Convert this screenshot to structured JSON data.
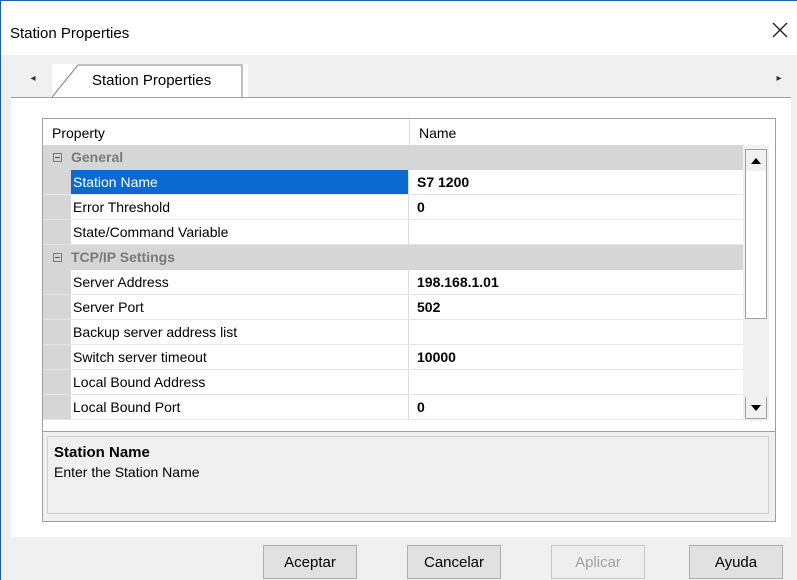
{
  "window": {
    "title": "Station Properties"
  },
  "tabs": {
    "active_label": "Station Properties",
    "left_arrow": "◂",
    "right_arrow": "▸"
  },
  "grid": {
    "header_property": "Property",
    "header_name": "Name",
    "rows": [
      {
        "type": "category",
        "label": "General"
      },
      {
        "type": "prop",
        "name": "Station Name",
        "value": "S7 1200",
        "selected": true
      },
      {
        "type": "prop",
        "name": "Error Threshold",
        "value": "0"
      },
      {
        "type": "prop",
        "name": "State/Command Variable",
        "value": ""
      },
      {
        "type": "category",
        "label": "TCP/IP Settings"
      },
      {
        "type": "prop",
        "name": "Server Address",
        "value": "198.168.1.01"
      },
      {
        "type": "prop",
        "name": "Server Port",
        "value": "502"
      },
      {
        "type": "prop",
        "name": "Backup server address list",
        "value": ""
      },
      {
        "type": "prop",
        "name": "Switch server timeout",
        "value": "10000"
      },
      {
        "type": "prop",
        "name": "Local Bound Address",
        "value": ""
      },
      {
        "type": "prop",
        "name": "Local Bound Port",
        "value": "0"
      }
    ]
  },
  "description": {
    "title": "Station Name",
    "text": "Enter the Station Name"
  },
  "buttons": {
    "ok": "Aceptar",
    "cancel": "Cancelar",
    "apply": "Aplicar",
    "help": "Ayuda"
  },
  "colors": {
    "selection": "#0a6ad2",
    "category_bg": "#d6d6d6",
    "window_border": "#1a5fb4"
  }
}
